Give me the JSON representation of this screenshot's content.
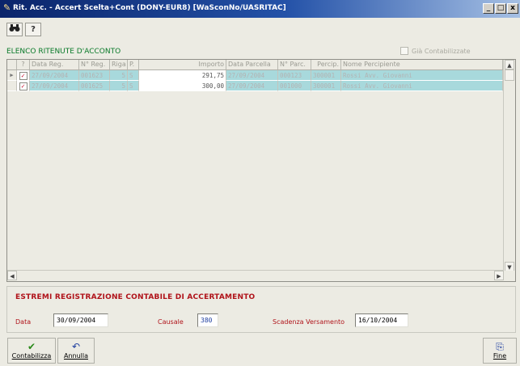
{
  "window": {
    "title": "Rit. Acc. - Accert Scelta+Cont (DONY-EUR8) [WaSconNo/UASRITAC]",
    "buttons": [
      "_",
      "□",
      "x"
    ]
  },
  "toolbar": {
    "search_icon": "binoculars-icon",
    "help_icon": "question-icon"
  },
  "section_label": "ELENCO RITENUTE D'ACCONTO",
  "already_posted": {
    "label": "Già Contabilizzate",
    "checked": false
  },
  "grid": {
    "headers": [
      "?",
      "Data Reg.",
      "N° Reg.",
      "Riga",
      "P.",
      "Importo",
      "Data Parcella",
      "N° Parc.",
      "Percip.",
      "Nome Percipiente"
    ],
    "rows": [
      {
        "current": true,
        "checked": true,
        "data_reg": "27/09/2004",
        "n_reg": "001623",
        "riga": "5",
        "p": "S",
        "importo": "291,75",
        "data_parcella": "27/09/2004",
        "n_parc": "000123",
        "percip": "300001",
        "nome": "Rossi Avv. Giovanni"
      },
      {
        "current": false,
        "checked": true,
        "data_reg": "27/09/2004",
        "n_reg": "001625",
        "riga": "5",
        "p": "S",
        "importo": "300,00",
        "data_parcella": "27/09/2004",
        "n_parc": "001000",
        "percip": "300001",
        "nome": "Rossi Avv. Giovanni"
      }
    ]
  },
  "panel": {
    "title": "ESTREMI REGISTRAZIONE CONTABILE DI ACCERTAMENTO",
    "data_label": "Data",
    "data_value": "30/09/2004",
    "causale_label": "Causale",
    "causale_value": "380",
    "scadenza_label": "Scadenza Versamento",
    "scadenza_value": "16/10/2004"
  },
  "actions": {
    "contabilizza": "Contabilizza",
    "annulla": "Annulla",
    "fine": "Fine"
  },
  "colors": {
    "accent_red": "#b0131a",
    "section_green": "#0a7a2a",
    "row_teal": "#a8d9dc",
    "title_blue": "#0a246a"
  }
}
